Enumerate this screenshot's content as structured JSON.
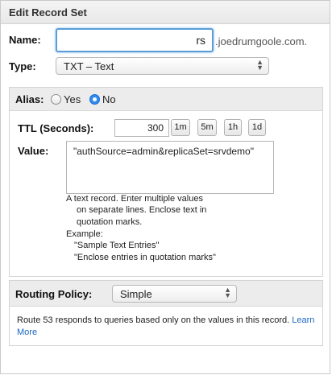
{
  "panel": {
    "title": "Edit Record Set"
  },
  "name": {
    "label": "Name:",
    "value": "rs",
    "suffix": ".joedrumgoole.com."
  },
  "type": {
    "label": "Type:",
    "selected": "TXT – Text"
  },
  "alias": {
    "label": "Alias:",
    "options": [
      "Yes",
      "No"
    ],
    "selected": "No"
  },
  "ttl": {
    "label": "TTL (Seconds):",
    "value": "300",
    "presets": [
      "1m",
      "5m",
      "1h",
      "1d"
    ]
  },
  "value": {
    "label": "Value:",
    "text": "\"authSource=admin&replicaSet=srvdemo\"",
    "help": [
      "A text record. Enter multiple values",
      "on separate lines. Enclose text in",
      "quotation marks.",
      "Example:",
      "\"Sample Text Entries\"",
      "\"Enclose entries in quotation marks\""
    ]
  },
  "routing": {
    "label": "Routing Policy:",
    "selected": "Simple",
    "description": "Route 53 responds to queries based only on the values in this record.",
    "learn_more": "Learn More"
  },
  "colors": {
    "focus_border": "#5b9dd9",
    "radio_selected": "#2e8bef",
    "link": "#1a66c0",
    "section_bar": "#ececec"
  }
}
